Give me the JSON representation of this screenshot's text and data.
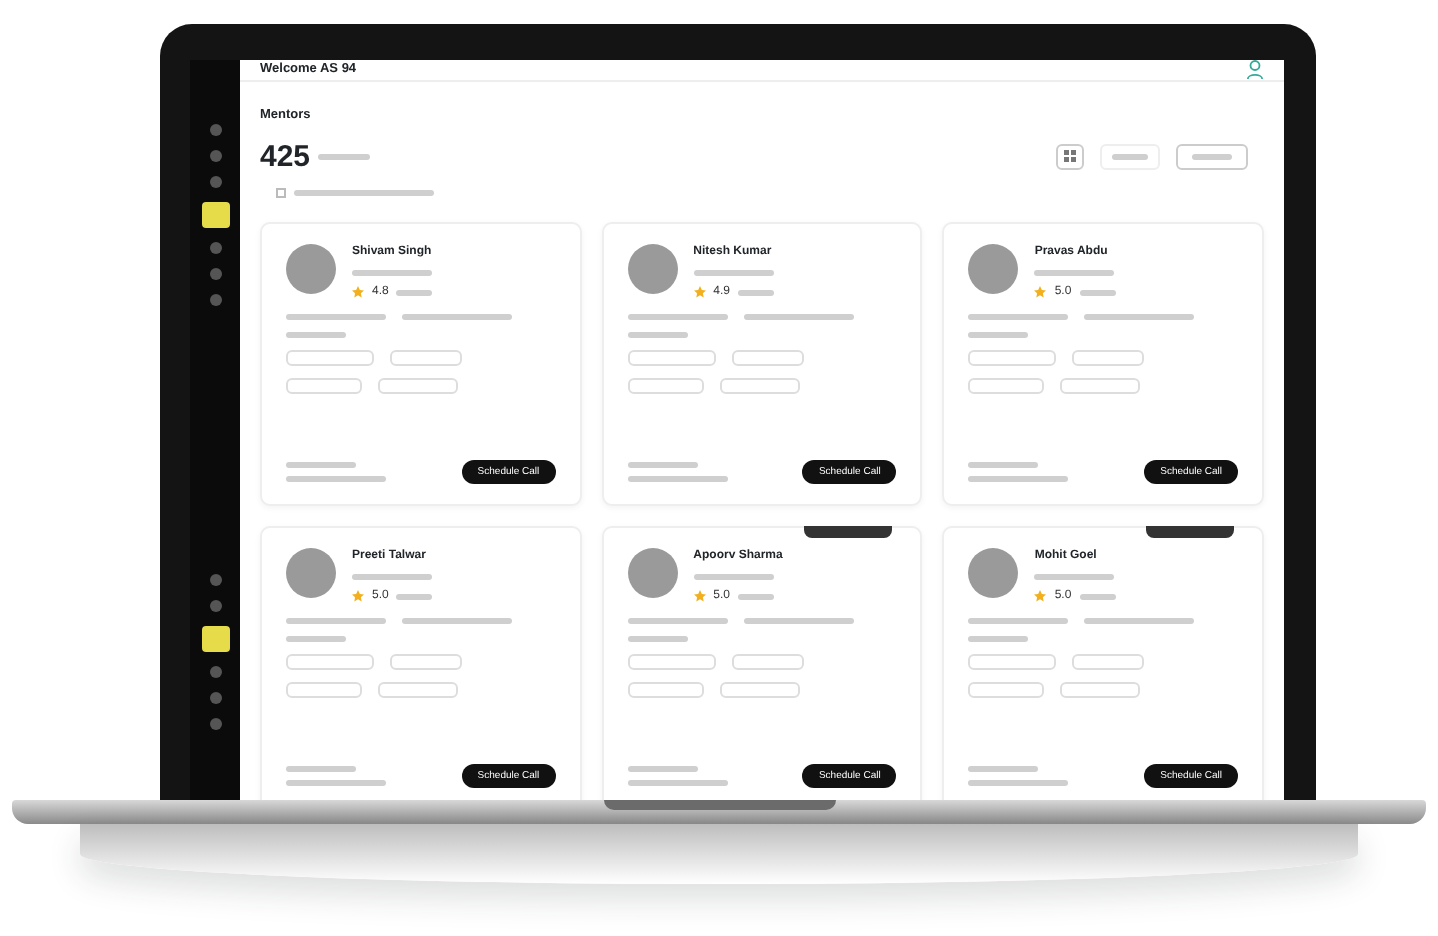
{
  "header": {
    "welcome": "Welcome AS 94"
  },
  "page_title": "Mentors",
  "summary": {
    "count": "425"
  },
  "filter_checkbox": {
    "checked": false
  },
  "sidebar": {
    "items": [
      {
        "selected": false
      },
      {
        "selected": false
      },
      {
        "selected": false
      },
      {
        "selected": true
      },
      {
        "selected": false
      },
      {
        "selected": false
      },
      {
        "selected": false
      }
    ],
    "items_lower": [
      {
        "selected": false
      },
      {
        "selected": false
      },
      {
        "selected": true
      },
      {
        "selected": false
      },
      {
        "selected": false
      },
      {
        "selected": false
      }
    ]
  },
  "mentors": [
    {
      "name": "Shivam Singh",
      "rating": "4.8",
      "featured": false,
      "button": "Schedule Call"
    },
    {
      "name": "Nitesh Kumar",
      "rating": "4.9",
      "featured": false,
      "button": "Schedule Call"
    },
    {
      "name": "Pravas Abdu",
      "rating": "5.0",
      "featured": false,
      "button": "Schedule Call"
    },
    {
      "name": "Preeti Talwar",
      "rating": "5.0",
      "featured": false,
      "button": "Schedule Call"
    },
    {
      "name": "Apoorv Sharma",
      "rating": "5.0",
      "featured": true,
      "button": "Schedule Call"
    },
    {
      "name": "Mohit Goel",
      "rating": "5.0",
      "featured": true,
      "button": "Schedule Call"
    }
  ]
}
